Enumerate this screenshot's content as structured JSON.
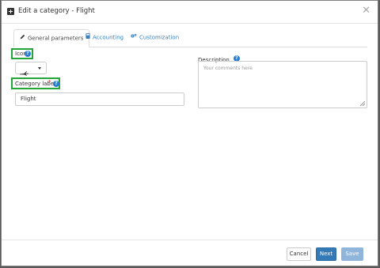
{
  "modal": {
    "title": "Edit a category - Flight"
  },
  "tabs": [
    {
      "label": "General parameters",
      "active": true,
      "icon": "pencil-icon"
    },
    {
      "label": "Accounting",
      "active": false,
      "icon": "calculator-icon"
    },
    {
      "label": "Customization",
      "active": false,
      "icon": "gears-icon"
    }
  ],
  "form": {
    "icon_label": "Icon",
    "icon_value": "plane-icon",
    "category_label": "Category label",
    "required_mark": "*",
    "category_value": "Flight",
    "description_label": "Description",
    "description_placeholder": "Your comments here",
    "help_glyph": "?"
  },
  "footer": {
    "cancel": "Cancel",
    "next": "Next",
    "save": "Save"
  },
  "colors": {
    "accent": "#337ab7",
    "link": "#3a7fc0",
    "highlight_box": "#26a63a"
  }
}
